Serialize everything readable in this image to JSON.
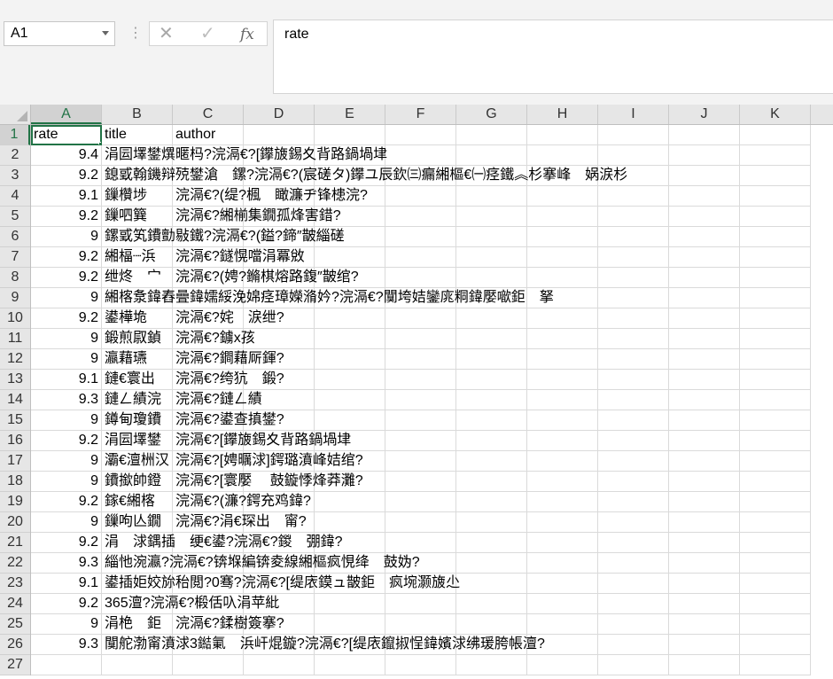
{
  "name_box": {
    "value": "A1"
  },
  "formula_bar": {
    "value": "rate",
    "insert_function_label": "fx"
  },
  "columns": [
    "A",
    "B",
    "C",
    "D",
    "E",
    "F",
    "G",
    "H",
    "I",
    "J",
    "K"
  ],
  "header_row": {
    "row": "1",
    "rate": "rate",
    "title": "title",
    "author": "author"
  },
  "rows": [
    {
      "row": "2",
      "rate": "9.4",
      "title": "涓囩墿鐢熼暱杩?浣滆€?[鑻旇錫夊背路鍋堝垏"
    },
    {
      "row": "3",
      "rate": "9.2",
      "title": "鎴戜翰鐖辩殑鐢滄　鏍?浣滆€?(宸磋タ)鑻ユ辰欽㈢瘺緗樞€㈠痉鐵︽杉搴峰　娲涙杉"
    },
    {
      "row": "4",
      "rate": "9.1",
      "title": "鏁欑埗",
      "author": "浣滆€?(缇?楓　瞰濂ヂ锋槵浣?"
    },
    {
      "row": "5",
      "rate": "9.2",
      "title": "鏁呬簨",
      "author": "浣滆€?緗椾集鐗孤烽害錯?"
    },
    {
      "row": "6",
      "rate": "9",
      "title": "鏍戜笂鐨勯敡鐵?浣滆€?(鎰?鍗″皵緇磋"
    },
    {
      "row": "7",
      "rate": "9.2",
      "title": "緗楅┈浜",
      "author": "浣滆€?鐩愰噹涓冪敓"
    },
    {
      "row": "8",
      "rate": "9.2",
      "title": "绁炵　宀",
      "author": "浣滆€?(娉?鏅棋熔路鍑″皵绾?"
    },
    {
      "row": "9",
      "rate": "9",
      "title": "緗楁洜鍏舂曡鍏嬬綏浼婂痉璋嬫潃妗?浣滆€?闃垮姞鑾庣粡鍏嬮噷鉅　拏"
    },
    {
      "row": "10",
      "rate": "9.2",
      "title": "鍙樺垝",
      "author": "浣滆€?姹　涙绁?"
    },
    {
      "row": "11",
      "rate": "9",
      "title": "鍛煎叞鍞",
      "author": "浣滆€?鐪х孩"
    },
    {
      "row": "12",
      "rate": "9",
      "title": "瀛藉瓙",
      "author": "浣滆€?鐧藉厛鍕?"
    },
    {
      "row": "13",
      "rate": "9.1",
      "title": "鏈€寰出",
      "author": "浣滆€?绔犺　鍛?"
    },
    {
      "row": "14",
      "rate": "9.3",
      "title": "鏈ㄥ績浣",
      "author": "浣滆€?鏈ㄥ績"
    },
    {
      "row": "15",
      "rate": "9",
      "title": "鐏甸瓊鐨",
      "author": "浣滆€?鍙查搷鐢?"
    },
    {
      "row": "16",
      "rate": "9.2",
      "title": "涓囩墿鐢",
      "author": "浣滆€?[鑻旇錫夊背路鍋堝垏"
    },
    {
      "row": "17",
      "rate": "9",
      "title": "灞€澶栦汉",
      "author": "浣滆€?[娉曞浗]鍔璐濆峰姞绾?"
    },
    {
      "row": "18",
      "rate": "9",
      "title": "鐨撳帥鐙",
      "author": "浣滆€?[寰嬮　 鼓鏇悸烽莽灘?"
    },
    {
      "row": "19",
      "rate": "9.2",
      "title": "鎵€緗楁",
      "author": "浣滆€?(濂?鍔充鸡鍏?"
    },
    {
      "row": "20",
      "rate": "9",
      "title": "鏁呴亾鐗",
      "author": "浣滆€?涓€琛出　甯?"
    },
    {
      "row": "21",
      "rate": "9.2",
      "title": "涓　浗鍝插　绠€鍙?浣滆€?鍐　弸鍏?"
    },
    {
      "row": "22",
      "rate": "9.3",
      "title": "緇忚涴瀛?浣滆€?锛堢編锛夌線緗樞疯悓绛　鼓妫?"
    },
    {
      "row": "23",
      "rate": "9.1",
      "title": "鍙插姖姣旀秮閲?0骞?浣滆€?[缇庡鏌ュ皵鉅　疯埦灏旇尐"
    },
    {
      "row": "24",
      "rate": "9.2",
      "title": "365澶?浣滆€?椴佸叺涓苹紕"
    },
    {
      "row": "25",
      "rate": "9",
      "title": "涓栬　鉅",
      "author": "浣滆€?鍒樹簽搴?"
    },
    {
      "row": "26",
      "rate": "9.3",
      "title": "闃舵渤甯濆浗3鐑氭　浜屽焜鏇?浣滆€?[缇庡鑹掓悜鍏嬪浗绋瑗胯帳澶?"
    },
    {
      "row": "27",
      "rate": "",
      "title": ""
    }
  ]
}
